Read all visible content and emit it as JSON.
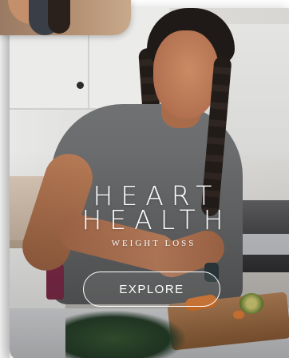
{
  "card": {
    "title_line_1": "HEART",
    "title_line_2": "HEALTH",
    "subtitle": "WEIGHT LOSS",
    "button_label": "EXPLORE"
  },
  "colors": {
    "overlay_text": "#ffffff",
    "shirt": "#6a6b6c",
    "counter": "#cfd0d3"
  },
  "icons": {
    "prev_card": "photo-thumbnail",
    "main_card": "photo-background"
  }
}
